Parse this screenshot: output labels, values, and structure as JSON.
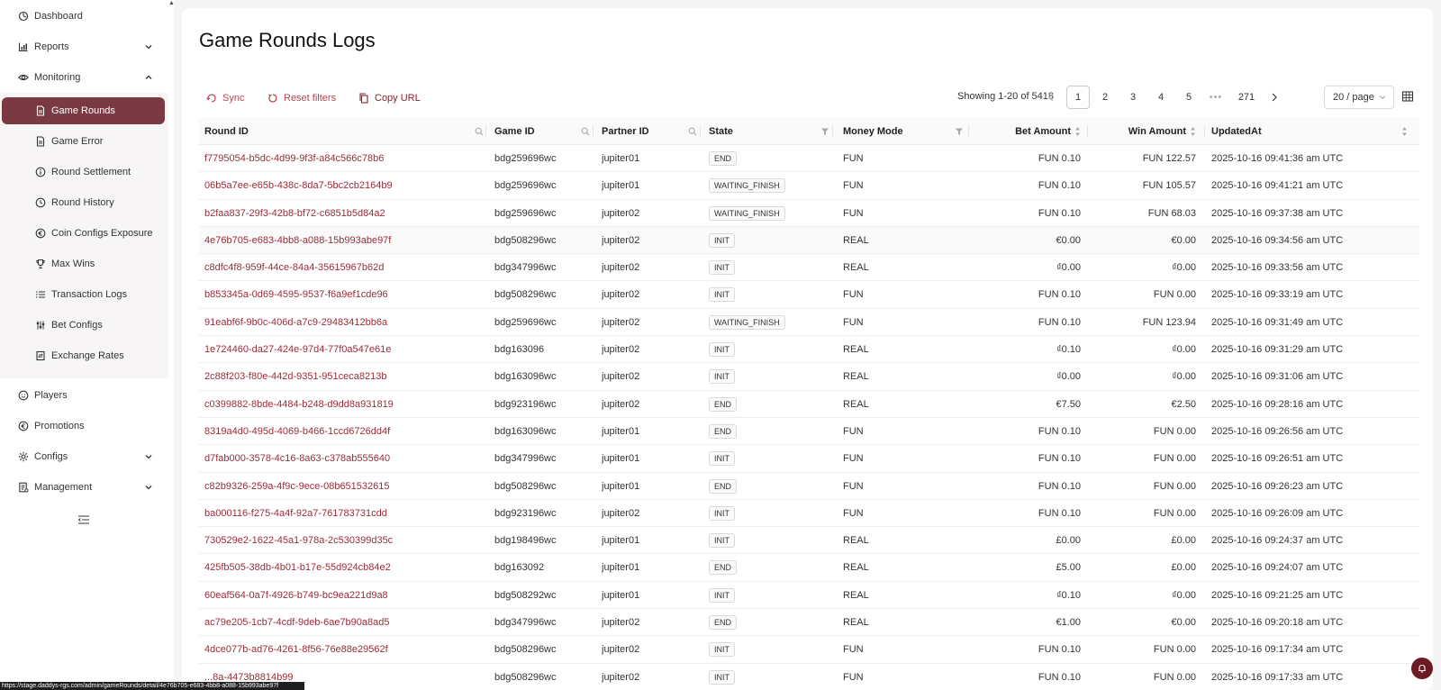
{
  "sidebar": {
    "items": [
      {
        "label": "Dashboard",
        "icon": "dashboard-icon"
      },
      {
        "label": "Reports",
        "icon": "bar-chart-icon"
      },
      {
        "label": "Monitoring",
        "icon": "eye-icon"
      },
      {
        "label": "Players",
        "icon": "smile-icon"
      },
      {
        "label": "Promotions",
        "icon": "euro-circle-icon"
      },
      {
        "label": "Configs",
        "icon": "gear-icon"
      },
      {
        "label": "Management",
        "icon": "document-list-icon"
      }
    ],
    "monitoring_items": [
      {
        "label": "Game Rounds",
        "icon": "document-icon",
        "active": true
      },
      {
        "label": "Game Error",
        "icon": "document-icon"
      },
      {
        "label": "Round Settlement",
        "icon": "info-circle-icon"
      },
      {
        "label": "Round History",
        "icon": "history-icon"
      },
      {
        "label": "Coin Configs Exposure",
        "icon": "euro-circle-icon"
      },
      {
        "label": "Max Wins",
        "icon": "trophy-icon"
      },
      {
        "label": "Transaction Logs",
        "icon": "list-icon"
      },
      {
        "label": "Bet Configs",
        "icon": "sliders-icon"
      },
      {
        "label": "Exchange Rates",
        "icon": "exchange-icon"
      }
    ]
  },
  "main": {
    "title": "Game Rounds Logs",
    "toolbar": {
      "sync_label": "Sync",
      "reset_label": "Reset filters",
      "copy_label": "Copy URL"
    },
    "pagination": {
      "showing": "Showing 1-20 of 5418",
      "pages": [
        "1",
        "2",
        "3",
        "4",
        "5"
      ],
      "dots": "•••",
      "last": "271",
      "current": "1",
      "page_size": "20 / page"
    },
    "columns": [
      "Round ID",
      "Game ID",
      "Partner ID",
      "State",
      "Money Mode",
      "Bet Amount",
      "Win Amount",
      "UpdatedAt"
    ],
    "rows": [
      [
        "f7795054-b5dc-4d99-9f3f-a84c566c78b6",
        "bdg259696wc",
        "jupiter01",
        "END",
        "FUN",
        "FUN 0.10",
        "FUN 122.57",
        "2025-10-16 09:41:36 am UTC"
      ],
      [
        "06b5a7ee-e65b-438c-8da7-5bc2cb2164b9",
        "bdg259696wc",
        "jupiter01",
        "WAITING_FINISH",
        "FUN",
        "FUN 0.10",
        "FUN 105.57",
        "2025-10-16 09:41:21 am UTC"
      ],
      [
        "b2faa837-29f3-42b8-bf72-c6851b5d84a2",
        "bdg259696wc",
        "jupiter02",
        "WAITING_FINISH",
        "FUN",
        "FUN 0.10",
        "FUN 68.03",
        "2025-10-16 09:37:38 am UTC"
      ],
      [
        "4e76b705-e683-4bb8-a088-15b993abe97f",
        "bdg508296wc",
        "jupiter02",
        "INIT",
        "REAL",
        "€0.00",
        "€0.00",
        "2025-10-16 09:34:56 am UTC"
      ],
      [
        "c8dfc4f8-959f-44ce-84a4-35615967b62d",
        "bdg347996wc",
        "jupiter02",
        "INIT",
        "REAL",
        "₫0.00",
        "₫0.00",
        "2025-10-16 09:33:56 am UTC"
      ],
      [
        "b853345a-0d69-4595-9537-f6a9ef1cde96",
        "bdg508296wc",
        "jupiter02",
        "INIT",
        "FUN",
        "FUN 0.10",
        "FUN 0.00",
        "2025-10-16 09:33:19 am UTC"
      ],
      [
        "91eabf6f-9b0c-406d-a7c9-29483412bb6a",
        "bdg259696wc",
        "jupiter02",
        "WAITING_FINISH",
        "FUN",
        "FUN 0.10",
        "FUN 123.94",
        "2025-10-16 09:31:49 am UTC"
      ],
      [
        "1e724460-da27-424e-97d4-77f0a547e61e",
        "bdg163096",
        "jupiter02",
        "INIT",
        "REAL",
        "₫0.10",
        "₫0.00",
        "2025-10-16 09:31:29 am UTC"
      ],
      [
        "2c88f203-f80e-442d-9351-951ceca8213b",
        "bdg163096wc",
        "jupiter02",
        "INIT",
        "REAL",
        "₫0.00",
        "₫0.00",
        "2025-10-16 09:31:06 am UTC"
      ],
      [
        "c0399882-8bde-4484-b248-d9dd8a931819",
        "bdg923196wc",
        "jupiter02",
        "END",
        "REAL",
        "€7.50",
        "€2.50",
        "2025-10-16 09:28:16 am UTC"
      ],
      [
        "8319a4d0-495d-4069-b466-1ccd6726dd4f",
        "bdg163096wc",
        "jupiter01",
        "END",
        "FUN",
        "FUN 0.10",
        "FUN 0.00",
        "2025-10-16 09:26:56 am UTC"
      ],
      [
        "d7fab000-3578-4c16-8a63-c378ab555640",
        "bdg347996wc",
        "jupiter01",
        "INIT",
        "FUN",
        "FUN 0.10",
        "FUN 0.00",
        "2025-10-16 09:26:51 am UTC"
      ],
      [
        "c82b9326-259a-4f9c-9ece-08b651532615",
        "bdg508296wc",
        "jupiter01",
        "END",
        "FUN",
        "FUN 0.10",
        "FUN 0.00",
        "2025-10-16 09:26:23 am UTC"
      ],
      [
        "ba000116-f275-4a4f-92a7-761783731cdd",
        "bdg923196wc",
        "jupiter02",
        "INIT",
        "FUN",
        "FUN 0.10",
        "FUN 0.00",
        "2025-10-16 09:26:09 am UTC"
      ],
      [
        "730529e2-1622-45a1-978a-2c530399d35c",
        "bdg198496wc",
        "jupiter01",
        "INIT",
        "REAL",
        "£0.00",
        "£0.00",
        "2025-10-16 09:24:37 am UTC"
      ],
      [
        "425fb505-38db-4b01-b17e-55d924cb84e2",
        "bdg163092",
        "jupiter01",
        "END",
        "REAL",
        "£5.00",
        "£0.00",
        "2025-10-16 09:24:07 am UTC"
      ],
      [
        "60eaf564-0a7f-4926-b749-bc9ea221d9a8",
        "bdg508292wc",
        "jupiter01",
        "INIT",
        "REAL",
        "₫0.10",
        "₫0.00",
        "2025-10-16 09:21:25 am UTC"
      ],
      [
        "ac79e205-1cb7-4cdf-9deb-6ae7b90a8ad5",
        "bdg347996wc",
        "jupiter02",
        "END",
        "REAL",
        "€1.00",
        "€0.00",
        "2025-10-16 09:20:18 am UTC"
      ],
      [
        "4dce077b-ad76-4261-8f56-76e88e29562f",
        "bdg508296wc",
        "jupiter02",
        "INIT",
        "FUN",
        "FUN 0.10",
        "FUN 0.00",
        "2025-10-16 09:17:34 am UTC"
      ],
      [
        "...8a-4473b8814b99",
        "bdg508296wc",
        "jupiter02",
        "INIT",
        "FUN",
        "FUN 0.10",
        "FUN 0.00",
        "2025-10-16 09:17:33 am UTC"
      ]
    ],
    "highlighted_row": 3
  },
  "status_url": "https://stage.daddys-rgs.com/admin/gameRounds/detail/4e76b705-e683-4bb8-a088-15b993abe97f",
  "colors": {
    "accent": "#7a3a43",
    "link": "#9a2c38",
    "toolbar": "#b8434f"
  }
}
